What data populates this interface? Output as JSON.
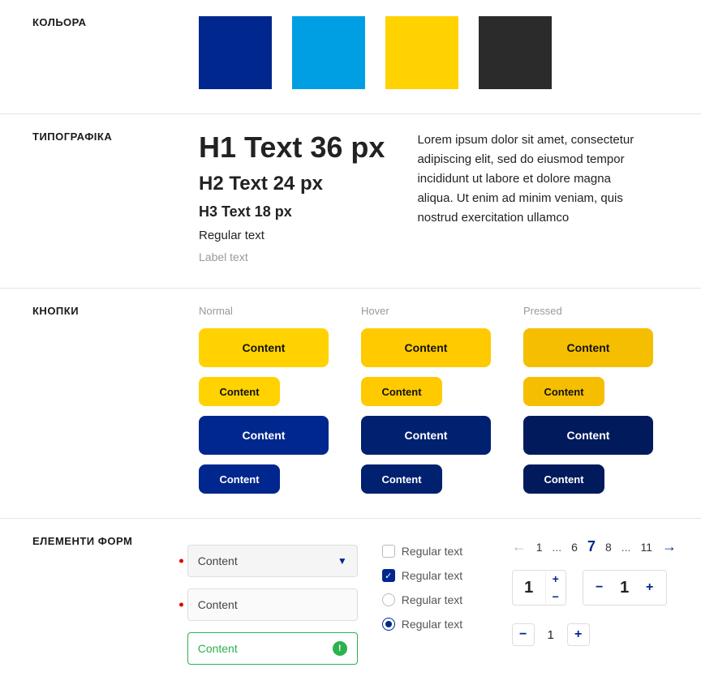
{
  "sections": {
    "colors": {
      "label": "КОЛЬОРА"
    },
    "typography": {
      "label": "ТИПОГРАФІКА"
    },
    "buttons": {
      "label": "КНОПКИ"
    },
    "forms": {
      "label": "ЕЛЕМЕНТИ ФОРМ"
    }
  },
  "palette": [
    "#00278d",
    "#009fe3",
    "#ffd200",
    "#2b2b2b"
  ],
  "typography": {
    "h1": "H1 Text 36 px",
    "h2": "H2 Text 24 px",
    "h3": "H3 Text 18 px",
    "regular": "Regular text",
    "label": "Label text",
    "paragraph": "Lorem ipsum dolor sit amet, consectetur adipiscing elit, sed do eiusmod tempor incididunt ut labore et dolore magna aliqua. Ut enim ad minim veniam, quis nostrud exercitation ullamco"
  },
  "button_states": {
    "normal": "Normal",
    "hover": "Hover",
    "pressed": "Pressed"
  },
  "button_label": "Content",
  "forms": {
    "select_value": "Content",
    "input_value": "Content",
    "input_ok_value": "Content",
    "check_label": "Regular text",
    "radio_label": "Regular text"
  },
  "pagination": {
    "pages": [
      "1",
      "...",
      "6",
      "7",
      "8",
      "...",
      "11"
    ],
    "current": "7"
  },
  "steppers": {
    "a": "1",
    "b": "1",
    "c": "1"
  }
}
